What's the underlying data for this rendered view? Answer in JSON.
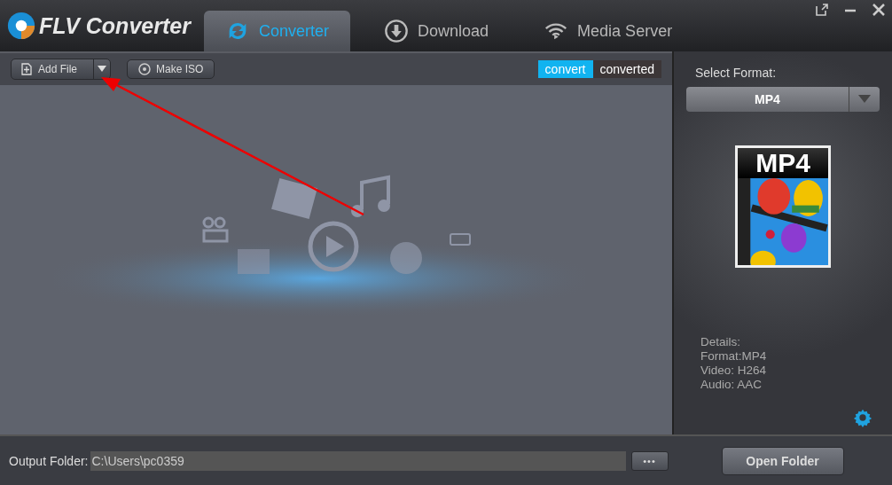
{
  "app_title": "FLV Converter",
  "tabs": [
    {
      "label": "Converter",
      "kind": "sync",
      "selected": true
    },
    {
      "label": "Download",
      "kind": "download",
      "selected": false
    },
    {
      "label": "Media Server",
      "kind": "wifi",
      "selected": false
    }
  ],
  "toolbar": {
    "add_file": "Add File",
    "make_iso": "Make ISO"
  },
  "view_toggle": [
    {
      "label": "convert",
      "selected": true
    },
    {
      "label": "converted",
      "selected": false
    }
  ],
  "format_panel": {
    "label": "Select Format:",
    "value": "MP4",
    "icon_label": "MP4",
    "details": [
      "Details:",
      "Format:MP4",
      "Video: H264",
      "Audio: AAC"
    ]
  },
  "output": {
    "label": "Output Folder:",
    "value": "C:\\Users\\pc0359",
    "browse": "•••",
    "open": "Open Folder"
  }
}
